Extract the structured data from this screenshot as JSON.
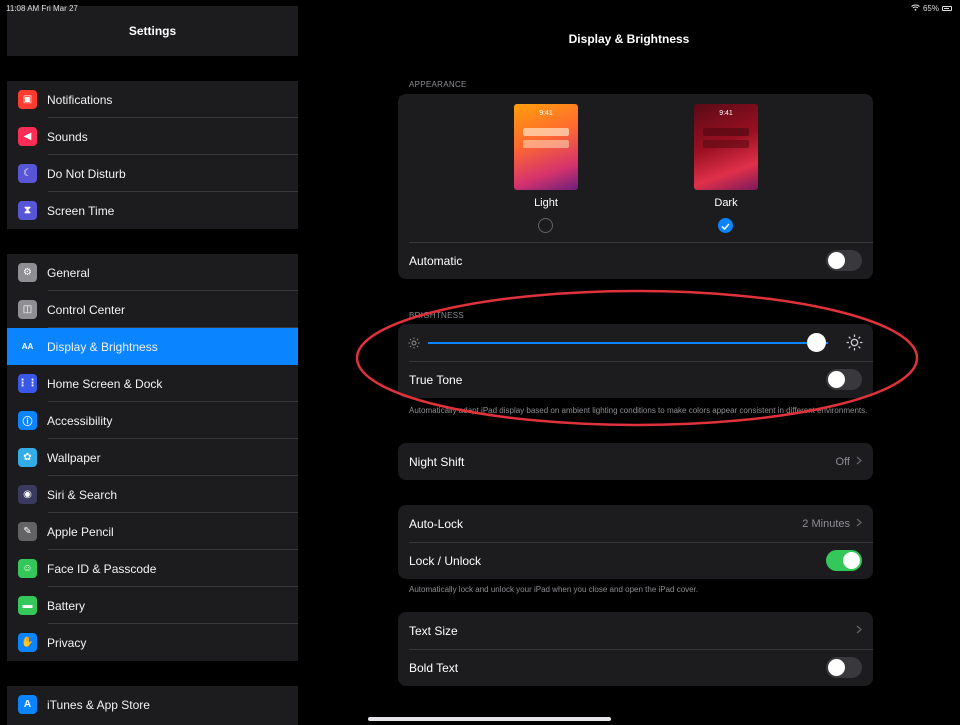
{
  "status": {
    "time": "11:08 AM  Fri Mar 27",
    "battery": "65%"
  },
  "sidebar": {
    "title": "Settings",
    "groups": [
      [
        {
          "label": "Notifications",
          "icon": "notifications-icon",
          "color": "#ff3b30"
        },
        {
          "label": "Sounds",
          "icon": "sounds-icon",
          "color": "#ff2d55"
        },
        {
          "label": "Do Not Disturb",
          "icon": "moon-icon",
          "color": "#5856d6"
        },
        {
          "label": "Screen Time",
          "icon": "hourglass-icon",
          "color": "#5856d6"
        }
      ],
      [
        {
          "label": "General",
          "icon": "gear-icon",
          "color": "#8e8e93"
        },
        {
          "label": "Control Center",
          "icon": "control-center-icon",
          "color": "#8e8e93"
        },
        {
          "label": "Display & Brightness",
          "icon": "display-icon",
          "color": "#0a84ff",
          "selected": true
        },
        {
          "label": "Home Screen & Dock",
          "icon": "home-grid-icon",
          "color": "#3a57e8"
        },
        {
          "label": "Accessibility",
          "icon": "accessibility-icon",
          "color": "#0a84ff"
        },
        {
          "label": "Wallpaper",
          "icon": "wallpaper-icon",
          "color": "#32ade6"
        },
        {
          "label": "Siri & Search",
          "icon": "siri-icon",
          "color": "#3a3a5e"
        },
        {
          "label": "Apple Pencil",
          "icon": "pencil-icon",
          "color": "#636366"
        },
        {
          "label": "Face ID & Passcode",
          "icon": "faceid-icon",
          "color": "#34c759"
        },
        {
          "label": "Battery",
          "icon": "battery-icon",
          "color": "#34c759"
        },
        {
          "label": "Privacy",
          "icon": "hand-icon",
          "color": "#0a84ff"
        }
      ],
      [
        {
          "label": "iTunes & App Store",
          "icon": "appstore-icon",
          "color": "#0a84ff"
        }
      ]
    ]
  },
  "main": {
    "title": "Display & Brightness",
    "appearance": {
      "section_label": "APPEARANCE",
      "light_label": "Light",
      "dark_label": "Dark",
      "thumb_time": "9:41",
      "selected": "Dark",
      "automatic_label": "Automatic",
      "automatic_on": false
    },
    "brightness": {
      "section_label": "BRIGHTNESS",
      "level": 0.97,
      "true_tone_label": "True Tone",
      "true_tone_on": false,
      "note": "Automatically adapt iPad display based on ambient lighting conditions to make colors appear consistent in different environments."
    },
    "night_shift": {
      "label": "Night Shift",
      "value": "Off"
    },
    "lock": {
      "auto_lock_label": "Auto-Lock",
      "auto_lock_value": "2 Minutes",
      "lock_unlock_label": "Lock / Unlock",
      "lock_unlock_on": true,
      "note": "Automatically lock and unlock your iPad when you close and open the iPad cover."
    },
    "text": {
      "text_size_label": "Text Size",
      "bold_text_label": "Bold Text",
      "bold_text_on": false
    },
    "annotation_color": "#e0323a"
  }
}
